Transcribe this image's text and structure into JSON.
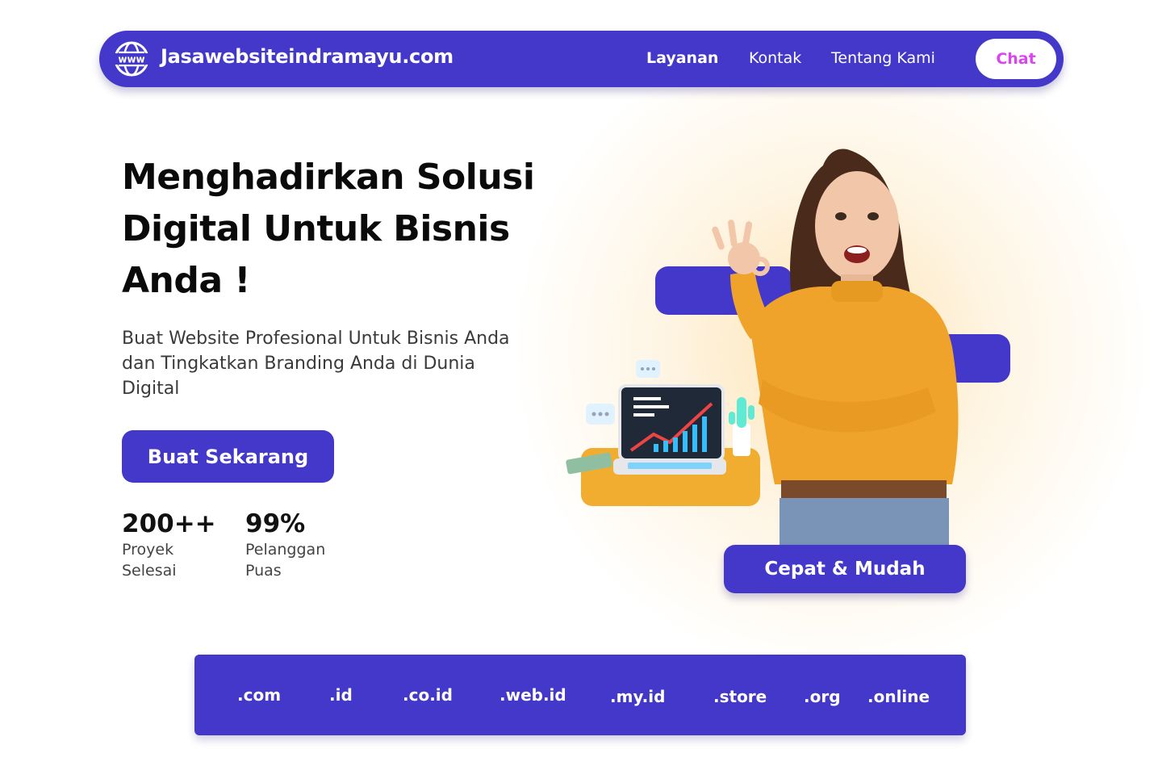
{
  "navbar": {
    "brand_icon_text": "www",
    "brand_name": "Jasawebsiteindramayu.com",
    "links": [
      "Layanan",
      "Kontak",
      "Tentang Kami"
    ],
    "chat_label": "Chat"
  },
  "hero": {
    "title": "Menghadirkan Solusi Digital Untuk Bisnis Anda !",
    "subtitle": "Buat Website Profesional Untuk Bisnis Anda dan Tingkatkan Branding Anda di Dunia Digital",
    "cta_label": "Buat Sekarang",
    "stats": [
      {
        "value": "200++",
        "label": "Proyek Selesai"
      },
      {
        "value": "99%",
        "label": "Pelanggan Puas"
      }
    ],
    "badge_label": "Cepat & Mudah"
  },
  "domains": [
    ".com",
    ".id",
    ".co.id",
    ".web.id",
    ".my.id",
    ".store",
    ".org",
    ".online"
  ],
  "colors": {
    "primary": "#4338ca",
    "chat_text": "#d946ef",
    "accent_orange": "#f0ad30",
    "glow": "#fdcd78"
  }
}
